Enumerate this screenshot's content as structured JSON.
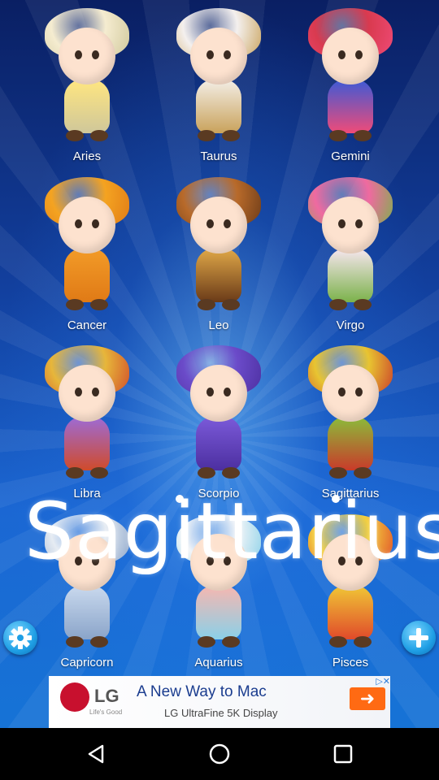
{
  "signs": [
    {
      "label": "Aries",
      "hat": "#f5ecd0",
      "body": "#ffe680",
      "accent": "#cfc79a"
    },
    {
      "label": "Taurus",
      "hat": "#f4f0ee",
      "body": "#f3eee6",
      "accent": "#c9a25b"
    },
    {
      "label": "Gemini",
      "hat": "#d93a4f",
      "body": "#3d5ad6",
      "accent": "#f04b78"
    },
    {
      "label": "Cancer",
      "hat": "#f4a321",
      "body": "#f29b28",
      "accent": "#e07a16"
    },
    {
      "label": "Leo",
      "hat": "#b86a2a",
      "body": "#e0a848",
      "accent": "#6a3a18"
    },
    {
      "label": "Virgo",
      "hat": "#ef6aa0",
      "body": "#f7e6ef",
      "accent": "#7bb24a"
    },
    {
      "label": "Libra",
      "hat": "#e7b63a",
      "body": "#9d6bd6",
      "accent": "#d04b2a"
    },
    {
      "label": "Scorpio",
      "hat": "#6b4bc9",
      "body": "#7b5ad9",
      "accent": "#4c2fa0"
    },
    {
      "label": "Sagittarius",
      "hat": "#e8c431",
      "body": "#8bbc3a",
      "accent": "#c93a2a"
    },
    {
      "label": "Capricorn",
      "hat": "#e6ecf3",
      "body": "#c9d9ee",
      "accent": "#8aa4c9"
    },
    {
      "label": "Aquarius",
      "hat": "#f2f5f8",
      "body": "#f6b7b0",
      "accent": "#8ad0e8"
    },
    {
      "label": "Pisces",
      "hat": "#f3cf3c",
      "body": "#f0c636",
      "accent": "#e04a2a"
    }
  ],
  "overlay_title": "Sagittarius",
  "icons": {
    "settings": "gear-icon",
    "add": "plus-icon",
    "back": "back-triangle-icon",
    "home": "home-circle-icon",
    "recents": "recents-square-icon"
  },
  "ad": {
    "brand": "LG",
    "brand_tag": "Life's Good",
    "headline": "A New Way to Mac",
    "subline": "LG UltraFine 5K Display",
    "choices": "▷✕"
  },
  "colors": {
    "bg_top": "#0a1f63",
    "bg_bottom": "#1673d6",
    "button": "#1f9fe5",
    "ad_red": "#c8102e"
  }
}
